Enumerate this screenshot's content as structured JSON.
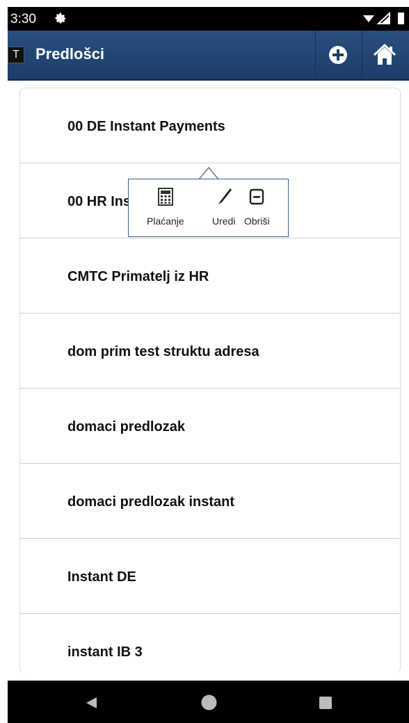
{
  "status_bar": {
    "time": "3:30",
    "settings_icon": "gear-icon",
    "wifi_icon": "wifi-icon",
    "signal_icon": "signal-icon",
    "battery_icon": "battery-icon"
  },
  "app_bar": {
    "logo_letter": "T",
    "title": "Predlošci",
    "add_icon": "plus-circle-icon",
    "home_icon": "home-icon",
    "color": "#1e4270"
  },
  "templates": [
    "00 DE Instant Payments",
    "00 HR Instant",
    "CMTC Primatelj iz HR",
    "dom prim test struktu adresa",
    "domaci predlozak",
    "domaci predlozak instant",
    "Instant DE",
    "instant IB 3"
  ],
  "popup_menu": {
    "items": [
      {
        "label": "Plaćanje",
        "icon": "calculator-icon"
      },
      {
        "label": "Uredi",
        "icon": "pen-icon"
      },
      {
        "label": "Obriši",
        "icon": "minus-box-icon"
      }
    ]
  },
  "nav_bar": {
    "back_icon": "back-triangle-icon",
    "home_icon": "home-circle-icon",
    "recents_icon": "recents-square-icon"
  }
}
